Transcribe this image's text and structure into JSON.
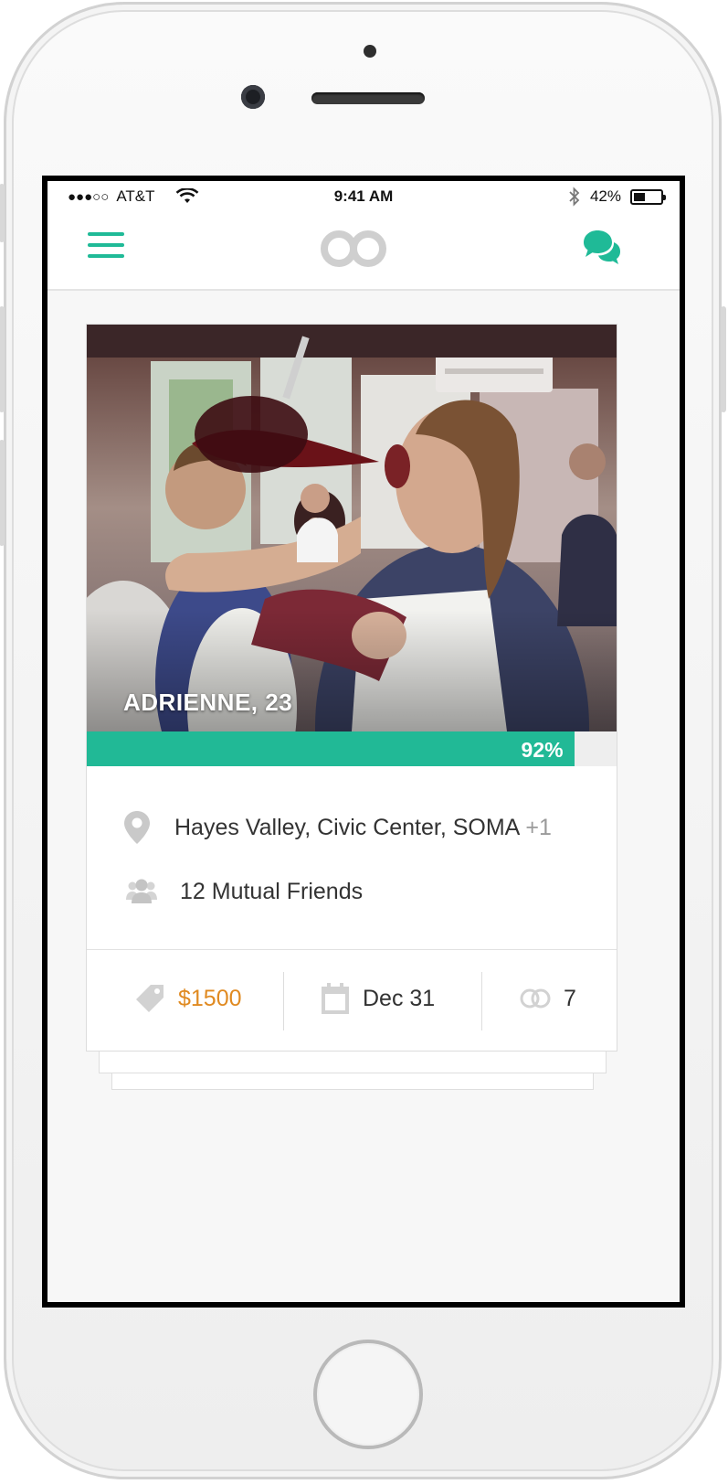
{
  "status_bar": {
    "signal": "●●●○○",
    "carrier": "AT&T",
    "time": "9:41 AM",
    "battery": "42%",
    "battery_level": 0.42
  },
  "nav": {
    "menu_icon": "hamburger-menu-icon",
    "logo_icon": "double-ring-logo-icon",
    "chat_icon": "chat-bubbles-icon"
  },
  "profile": {
    "name_age": "ADRIENNE, 23",
    "match_percent_text": "92%",
    "match_percent": 92,
    "location": "Hayes Valley, Civic Center, SOMA",
    "location_extra": "+1",
    "mutual_friends": "12 Mutual Friends",
    "price": "$1500",
    "date": "Dec 31",
    "rings": "7"
  },
  "colors": {
    "accent": "#1fba97",
    "match_bar": "#21b996",
    "price": "#e08a21",
    "icon_gray": "#c9c9c9"
  }
}
